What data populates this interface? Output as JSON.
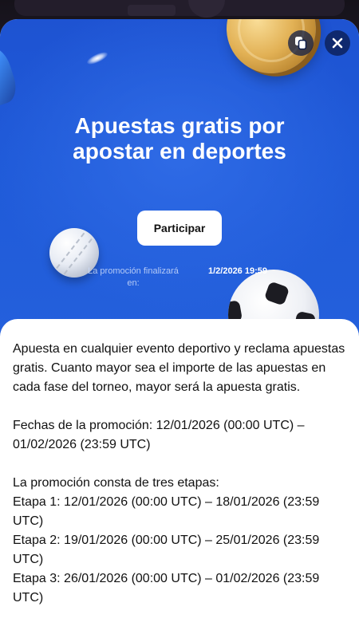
{
  "hero": {
    "title": "Apuestas gratis por apostar en deportes",
    "participate_label": "Participar",
    "promo_ends_label": "La promoción finalizará en:",
    "promo_ends_value": "1/2/2026 19:59",
    "accent_color": "#1e53d2"
  },
  "toolbar": {
    "share_icon": "copy-icon",
    "close_icon": "close-icon"
  },
  "description": {
    "intro": "Apuesta en cualquier evento deportivo y reclama apuestas gratis. Cuanto mayor sea el importe de las apuestas en cada fase del torneo, mayor será la apuesta gratis.",
    "dates": "Fechas de la promoción: 12/01/2026 (00:00 UTC) – 01/02/2026 (23:59 UTC)",
    "stages_heading": "La promoción consta de tres etapas:",
    "stages": [
      "Etapa 1: 12/01/2026 (00:00 UTC) – 18/01/2026 (23:59 UTC)",
      "Etapa 2: 19/01/2026 (00:00 UTC) – 25/01/2026 (23:59 UTC)",
      "Etapa 3: 26/01/2026 (00:00 UTC) – 01/02/2026 (23:59 UTC)"
    ]
  }
}
